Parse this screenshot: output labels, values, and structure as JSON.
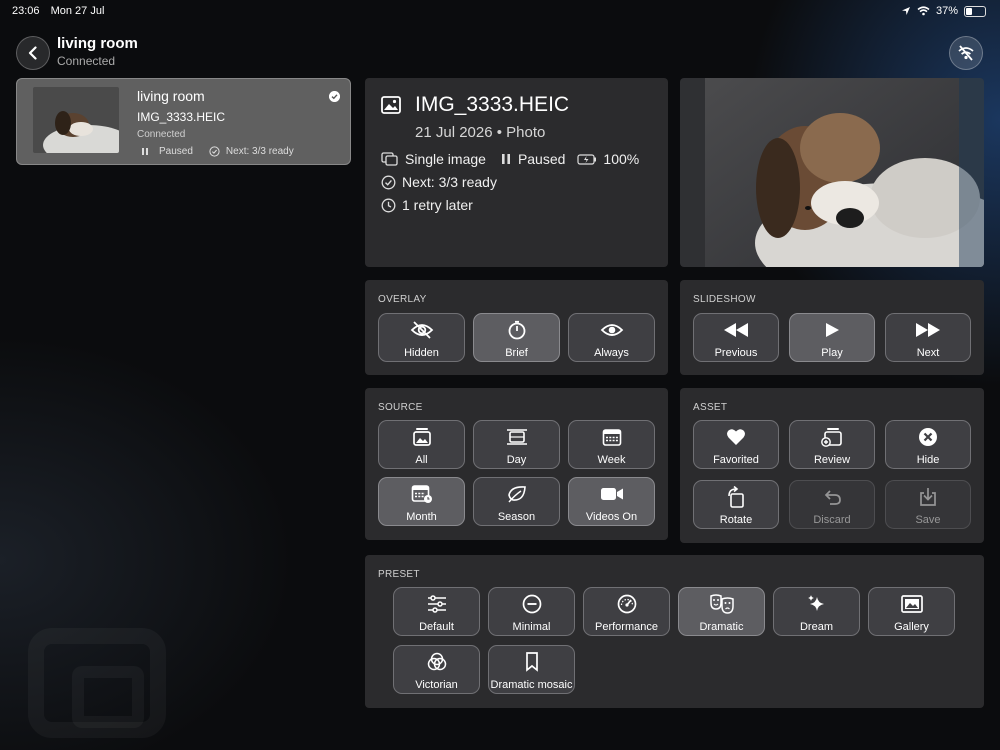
{
  "status_bar": {
    "time": "23:06",
    "date": "Mon 27 Jul",
    "battery": "37%"
  },
  "nav": {
    "title": "living room",
    "subtitle": "Connected"
  },
  "device": {
    "name": "living room",
    "file": "IMG_3333.HEIC",
    "status": "Connected",
    "playback": "Paused",
    "next": "Next: 3/3 ready"
  },
  "info": {
    "filename": "IMG_3333.HEIC",
    "date_type": "21 Jul 2026 • Photo",
    "mode": "Single image",
    "playback": "Paused",
    "battery": "100%",
    "next": "Next: 3/3 ready",
    "retry": "1 retry later"
  },
  "overlay": {
    "label": "OVERLAY",
    "buttons": [
      {
        "label": "Hidden",
        "icon": "eye-slash-icon"
      },
      {
        "label": "Brief",
        "icon": "timer-icon",
        "active": true
      },
      {
        "label": "Always",
        "icon": "eye-icon"
      }
    ]
  },
  "slideshow": {
    "label": "SLIDESHOW",
    "buttons": [
      {
        "label": "Previous",
        "icon": "backward-icon"
      },
      {
        "label": "Play",
        "icon": "play-icon",
        "active": true
      },
      {
        "label": "Next",
        "icon": "forward-icon"
      }
    ]
  },
  "source": {
    "label": "SOURCE",
    "buttons": [
      {
        "label": "All",
        "icon": "photo-stack-icon"
      },
      {
        "label": "Day",
        "icon": "day-icon"
      },
      {
        "label": "Week",
        "icon": "calendar-week-icon"
      },
      {
        "label": "Month",
        "icon": "calendar-month-icon",
        "active": true
      },
      {
        "label": "Season",
        "icon": "leaf-icon"
      },
      {
        "label": "Videos On",
        "icon": "video-icon",
        "active": true
      }
    ]
  },
  "asset": {
    "label": "ASSET",
    "buttons": [
      {
        "label": "Favorited",
        "icon": "heart-icon"
      },
      {
        "label": "Review",
        "icon": "review-icon"
      },
      {
        "label": "Hide",
        "icon": "x-circle-icon"
      },
      {
        "label": "Rotate",
        "icon": "rotate-icon"
      },
      {
        "label": "Discard",
        "icon": "undo-icon",
        "disabled": true
      },
      {
        "label": "Save",
        "icon": "download-icon",
        "disabled": true
      }
    ]
  },
  "preset": {
    "label": "PRESET",
    "buttons": [
      {
        "label": "Default",
        "icon": "sliders-icon"
      },
      {
        "label": "Minimal",
        "icon": "minus-circle-icon"
      },
      {
        "label": "Performance",
        "icon": "gauge-icon"
      },
      {
        "label": "Dramatic",
        "icon": "theater-masks-icon",
        "active": true
      },
      {
        "label": "Dream",
        "icon": "sparkles-icon"
      },
      {
        "label": "Gallery",
        "icon": "framed-picture-icon"
      },
      {
        "label": "Victorian",
        "icon": "circles-icon"
      },
      {
        "label": "Dramatic mosaic",
        "icon": "bookmark-icon"
      }
    ]
  },
  "colors": {
    "background": "#0b0c0e",
    "panel": "#2b2b2d",
    "button": "#3f3f43",
    "button_active": "#5d5d61"
  }
}
